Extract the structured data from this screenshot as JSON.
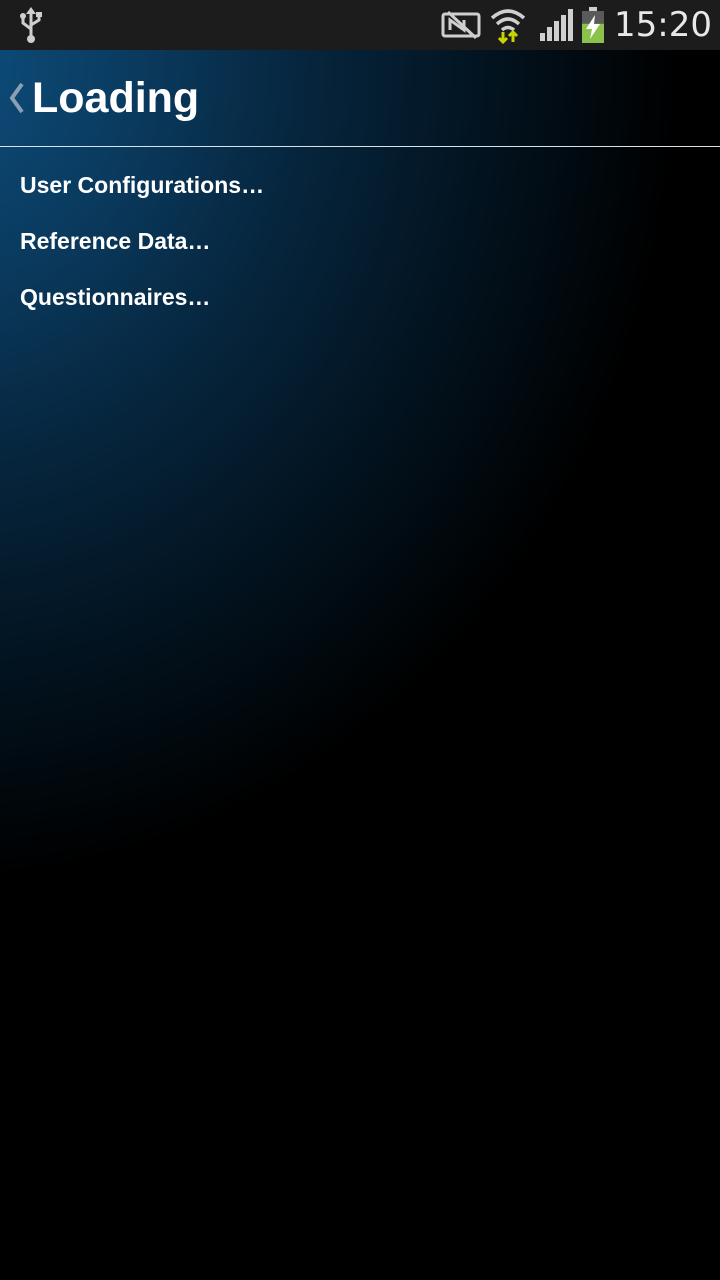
{
  "status_bar": {
    "time": "15:20",
    "icons": [
      "usb-icon",
      "nfc-off-icon",
      "wifi-icon",
      "signal-icon",
      "battery-charging-icon"
    ],
    "battery_level": 0.6
  },
  "action_bar": {
    "title": "Loading",
    "back_icon": "chevron-left-icon"
  },
  "loading_items": [
    {
      "label": "User Configurations…"
    },
    {
      "label": "Reference Data…"
    },
    {
      "label": "Questionnaires…"
    }
  ],
  "colors": {
    "status_bar_bg": "#1c1c1c",
    "gradient_accent": "#0d4f7e",
    "text": "#ffffff",
    "battery": "#8bc34a",
    "wifi_arrows": "#c8d400"
  }
}
